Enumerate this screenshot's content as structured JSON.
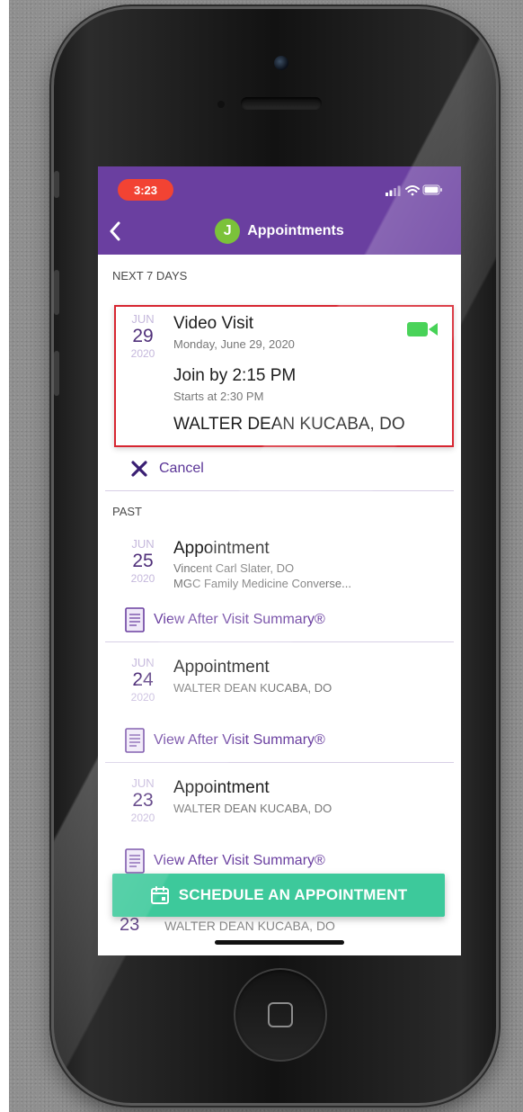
{
  "status_bar": {
    "time": "3:23"
  },
  "nav": {
    "avatar_initial": "J",
    "title": "Appointments"
  },
  "upcoming": {
    "section_label": "NEXT 7 DAYS",
    "appointment": {
      "month": "JUN",
      "day": "29",
      "year": "2020",
      "title": "Video Visit",
      "date_text": "Monday, June 29, 2020",
      "join_by": "Join by 2:15 PM",
      "starts_at": "Starts at 2:30 PM",
      "provider": "WALTER DEAN KUCABA, DO"
    },
    "cancel_label": "Cancel"
  },
  "past": {
    "section_label": "PAST",
    "appointments": [
      {
        "month": "JUN",
        "day": "25",
        "year": "2020",
        "title": "Appointment",
        "provider": "Vincent Carl Slater, DO",
        "location": "MGC Family Medicine Converse...",
        "summary_label": "View After Visit Summary®"
      },
      {
        "month": "JUN",
        "day": "24",
        "year": "2020",
        "title": "Appointment",
        "provider": "WALTER DEAN KUCABA, DO",
        "summary_label": "View After Visit Summary®"
      },
      {
        "month": "JUN",
        "day": "23",
        "year": "2020",
        "title": "Appointment",
        "provider": "WALTER DEAN KUCABA, DO",
        "summary_label": "View After Visit Summary®"
      }
    ],
    "partial_row": {
      "day": "23",
      "provider": "WALTER DEAN KUCABA, DO"
    }
  },
  "schedule_button": {
    "label": "SCHEDULE AN APPOINTMENT"
  },
  "colors": {
    "header_purple": "#6a3fa0",
    "accent_green": "#3dc99b",
    "status_red": "#f24333",
    "highlight_red": "#d72631",
    "video_green": "#2ecc40"
  },
  "icons": {
    "back": "chevron-left-icon",
    "video": "video-camera-icon",
    "cancel": "close-icon",
    "summary": "document-icon",
    "schedule": "calendar-icon",
    "signal": "signal-icon",
    "wifi": "wifi-icon",
    "battery": "battery-icon"
  }
}
